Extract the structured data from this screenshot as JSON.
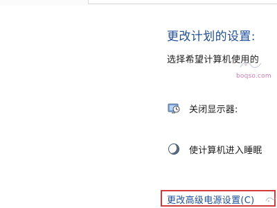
{
  "heading": "更改计划的设置:",
  "subheading": "选择希望计算机使用的",
  "settings": {
    "monitor": {
      "label": "关闭显示器:",
      "icon": "monitor-clock-icon"
    },
    "sleep": {
      "label": "使计算机进入睡眠",
      "icon": "moon-sleep-icon"
    }
  },
  "advanced_link": "更改高级电源设置(C)",
  "watermark": "boqso.com",
  "colors": {
    "heading_blue": "#1f4f9b",
    "text_dark": "#1a1a1a",
    "highlight_red": "#d33b3b",
    "watermark_pink": "#d47cae"
  }
}
